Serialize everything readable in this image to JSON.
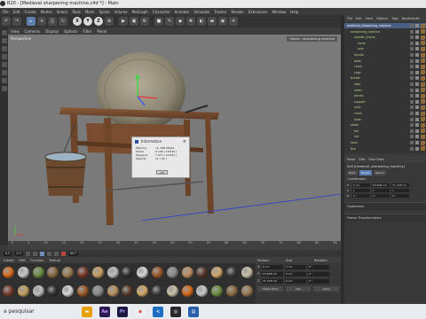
{
  "window": {
    "title": "R20 - [Medieval sharpening machine.c4d *] - Main"
  },
  "menubar": {
    "items": [
      "File",
      "Edit",
      "Create",
      "Modes",
      "Select",
      "Tools",
      "Mesh",
      "Spline",
      "Volume",
      "MoGraph",
      "Character",
      "Animate",
      "Simulate",
      "Tracker",
      "Render",
      "Extensions",
      "Window",
      "Help"
    ]
  },
  "viewport": {
    "menu": [
      "View",
      "Cameras",
      "Display",
      "Options",
      "Filter",
      "Panel"
    ],
    "label": "Perspective",
    "camera": "Object : sharpening machine"
  },
  "dialog": {
    "title": "Information",
    "rows": [
      {
        "k": "Memory",
        "v": "ca. 188 Mbyte"
      },
      {
        "k": "Points",
        "v": "9 100 (  18 940 )"
      },
      {
        "k": "Polygons",
        "v": "7 977 (  14 831 )"
      },
      {
        "k": "Objects",
        "v": "11 ( 40 )"
      }
    ],
    "ok": "OK"
  },
  "timeline": {
    "ticks": [
      "0",
      "5",
      "10",
      "15",
      "20",
      "25",
      "30",
      "35",
      "40",
      "45",
      "50",
      "55",
      "60",
      "65",
      "70",
      "75",
      "80",
      "85",
      "90"
    ],
    "start": "0 F",
    "end": "90 F",
    "current": "0 F"
  },
  "materials": {
    "menu": [
      "Create",
      "Edit",
      "Function",
      "Texture"
    ]
  },
  "coords": {
    "headers": [
      "Position",
      "Size",
      "Rotation"
    ],
    "rows": [
      {
        "ax": "X",
        "pos": "0 cm",
        "size": "0 cm",
        "rot": "0 °"
      },
      {
        "ax": "Y",
        "pos": "53.696 cm",
        "size": "0 cm",
        "rot": "0 °"
      },
      {
        "ax": "Z",
        "pos": "71.198 cm",
        "size": "0 cm",
        "rot": "0 °"
      }
    ],
    "object_mode": "Object (Rel)",
    "size_mode": "Size",
    "apply": "Apply"
  },
  "objects": {
    "menu": [
      "File",
      "Edit",
      "View",
      "Objects",
      "Tags",
      "Bookmarks"
    ],
    "items": [
      {
        "label": "medieval_sharpening_machine",
        "indent": 0,
        "selected": true
      },
      {
        "label": "sharpening_machine",
        "indent": 1,
        "selected": false
      },
      {
        "label": "wooden_frame",
        "indent": 2,
        "selected": false
      },
      {
        "label": "stone",
        "indent": 3,
        "selected": false
      },
      {
        "label": "axle",
        "indent": 3,
        "selected": false
      },
      {
        "label": "handle",
        "indent": 2,
        "selected": false
      },
      {
        "label": "bolts",
        "indent": 2,
        "selected": false
      },
      {
        "label": "crank",
        "indent": 2,
        "selected": false
      },
      {
        "label": "Legs",
        "indent": 2,
        "selected": false
      },
      {
        "label": "bucket",
        "indent": 1,
        "selected": false
      },
      {
        "label": "rope",
        "indent": 2,
        "selected": false
      },
      {
        "label": "water",
        "indent": 2,
        "selected": false
      },
      {
        "label": "planks",
        "indent": 2,
        "selected": false
      },
      {
        "label": "support",
        "indent": 2,
        "selected": false
      },
      {
        "label": "nails",
        "indent": 2,
        "selected": false
      },
      {
        "label": "chain",
        "indent": 2,
        "selected": false
      },
      {
        "label": "hook",
        "indent": 2,
        "selected": false
      },
      {
        "label": "pedal",
        "indent": 1,
        "selected": false
      },
      {
        "label": "bar",
        "indent": 2,
        "selected": false
      },
      {
        "label": "rod",
        "indent": 2,
        "selected": false
      },
      {
        "label": "base",
        "indent": 1,
        "selected": false
      },
      {
        "label": "Null",
        "indent": 1,
        "selected": false
      }
    ]
  },
  "attributes": {
    "menu": [
      "Mode",
      "Edit",
      "User Data"
    ],
    "title": "Null [medieval_sharpening_machine]",
    "tabs": [
      "Basic",
      "Coord.",
      "Object"
    ],
    "section": "Coordinates",
    "rows": [
      {
        "a": "P",
        "x": "0 cm",
        "y": "53.696 cm",
        "z": "71.198 cm"
      },
      {
        "a": "S",
        "x": "1",
        "y": "1",
        "z": "1"
      },
      {
        "a": "R",
        "x": "0 °",
        "y": "0 °",
        "z": "0 °"
      }
    ],
    "groups": [
      "Quaternion",
      "Freeze Transformation"
    ]
  },
  "taskbar": {
    "search_placeholder": "a pesquisar"
  }
}
